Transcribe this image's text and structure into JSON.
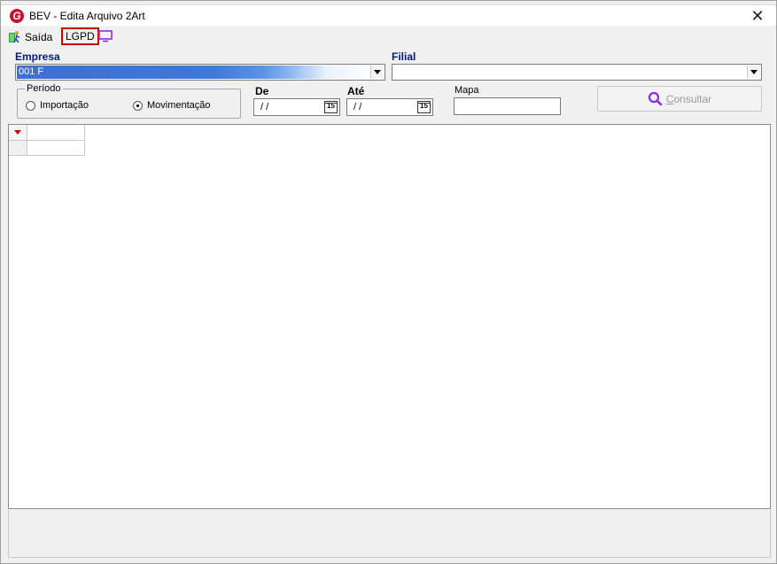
{
  "window": {
    "title": "BEV - Edita Arquivo 2Art",
    "logo_letter": "G",
    "close_symbol": "✕"
  },
  "toolbar": {
    "exit_label": "Saída",
    "lgpd_label": "LGPD"
  },
  "filters": {
    "empresa_label": "Empresa",
    "empresa_value": "001 F",
    "filial_label": "Filial",
    "filial_value": "",
    "periodo": {
      "legend": "Período",
      "options": [
        {
          "label": "Importação",
          "checked": false
        },
        {
          "label": "Movimentação",
          "checked": true
        }
      ]
    },
    "de_label": "De",
    "de_value": "/ /",
    "ate_label": "Até",
    "ate_value": "/ /",
    "calendar_icon_text": "15",
    "mapa_label": "Mapa",
    "mapa_value": ""
  },
  "actions": {
    "consultar_hotkey": "C",
    "consultar_rest": "onsultar"
  },
  "colors": {
    "accent_red": "#d00000",
    "label_blue": "#001a80",
    "search_icon_purple": "#8b2be2"
  },
  "icons": [
    "app-logo-icon",
    "exit-icon",
    "monitor-icon",
    "calendar-icon",
    "search-icon",
    "dropdown-arrow-icon"
  ]
}
